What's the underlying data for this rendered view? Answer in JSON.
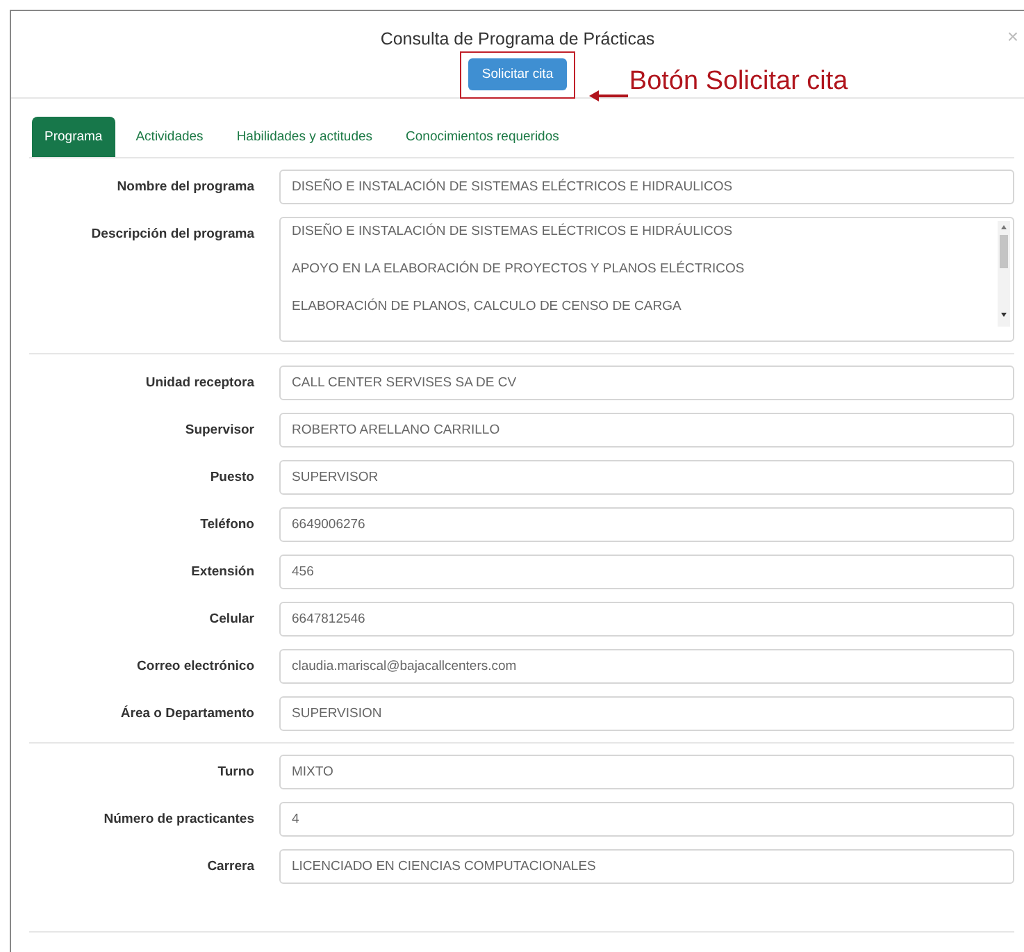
{
  "modal": {
    "title": "Consulta de Programa de Prácticas",
    "close": "×",
    "button": "Solicitar cita"
  },
  "annotation": {
    "label": "Botón Solicitar cita"
  },
  "tabs": [
    {
      "label": "Programa",
      "selected": true
    },
    {
      "label": "Actividades",
      "selected": false
    },
    {
      "label": "Habilidades y actitudes",
      "selected": false
    },
    {
      "label": "Conocimientos requeridos",
      "selected": false
    }
  ],
  "sections": [
    {
      "fields": [
        {
          "kind": "input",
          "label": "Nombre del programa",
          "value": "DISEÑO E INSTALACIÓN DE SISTEMAS ELÉCTRICOS E HIDRAULICOS"
        },
        {
          "kind": "textarea",
          "label": "Descripción del programa",
          "lines": [
            "DISEÑO E INSTALACIÓN DE SISTEMAS ELÉCTRICOS E HIDRÁULICOS",
            "APOYO EN LA ELABORACIÓN DE PROYECTOS Y PLANOS ELÉCTRICOS",
            "ELABORACIÓN DE PLANOS, CALCULO DE CENSO DE CARGA"
          ]
        }
      ]
    },
    {
      "fields": [
        {
          "kind": "input",
          "label": "Unidad receptora",
          "value": "CALL CENTER SERVISES SA DE CV"
        },
        {
          "kind": "input",
          "label": "Supervisor",
          "value": "ROBERTO ARELLANO CARRILLO"
        },
        {
          "kind": "input",
          "label": "Puesto",
          "value": "SUPERVISOR"
        },
        {
          "kind": "input",
          "label": "Teléfono",
          "value": "6649006276"
        },
        {
          "kind": "input",
          "label": "Extensión",
          "value": "456"
        },
        {
          "kind": "input",
          "label": "Celular",
          "value": "6647812546"
        },
        {
          "kind": "input",
          "label": "Correo electrónico",
          "value": "claudia.mariscal@bajacallcenters.com"
        },
        {
          "kind": "input",
          "label": "Área o Departamento",
          "value": "SUPERVISION"
        }
      ]
    },
    {
      "fields": [
        {
          "kind": "input",
          "label": "Turno",
          "value": "MIXTO"
        },
        {
          "kind": "input",
          "label": "Número de practicantes",
          "value": "4"
        },
        {
          "kind": "input",
          "label": "Carrera",
          "value": "LICENCIADO EN CIENCIAS COMPUTACIONALES"
        }
      ]
    }
  ]
}
